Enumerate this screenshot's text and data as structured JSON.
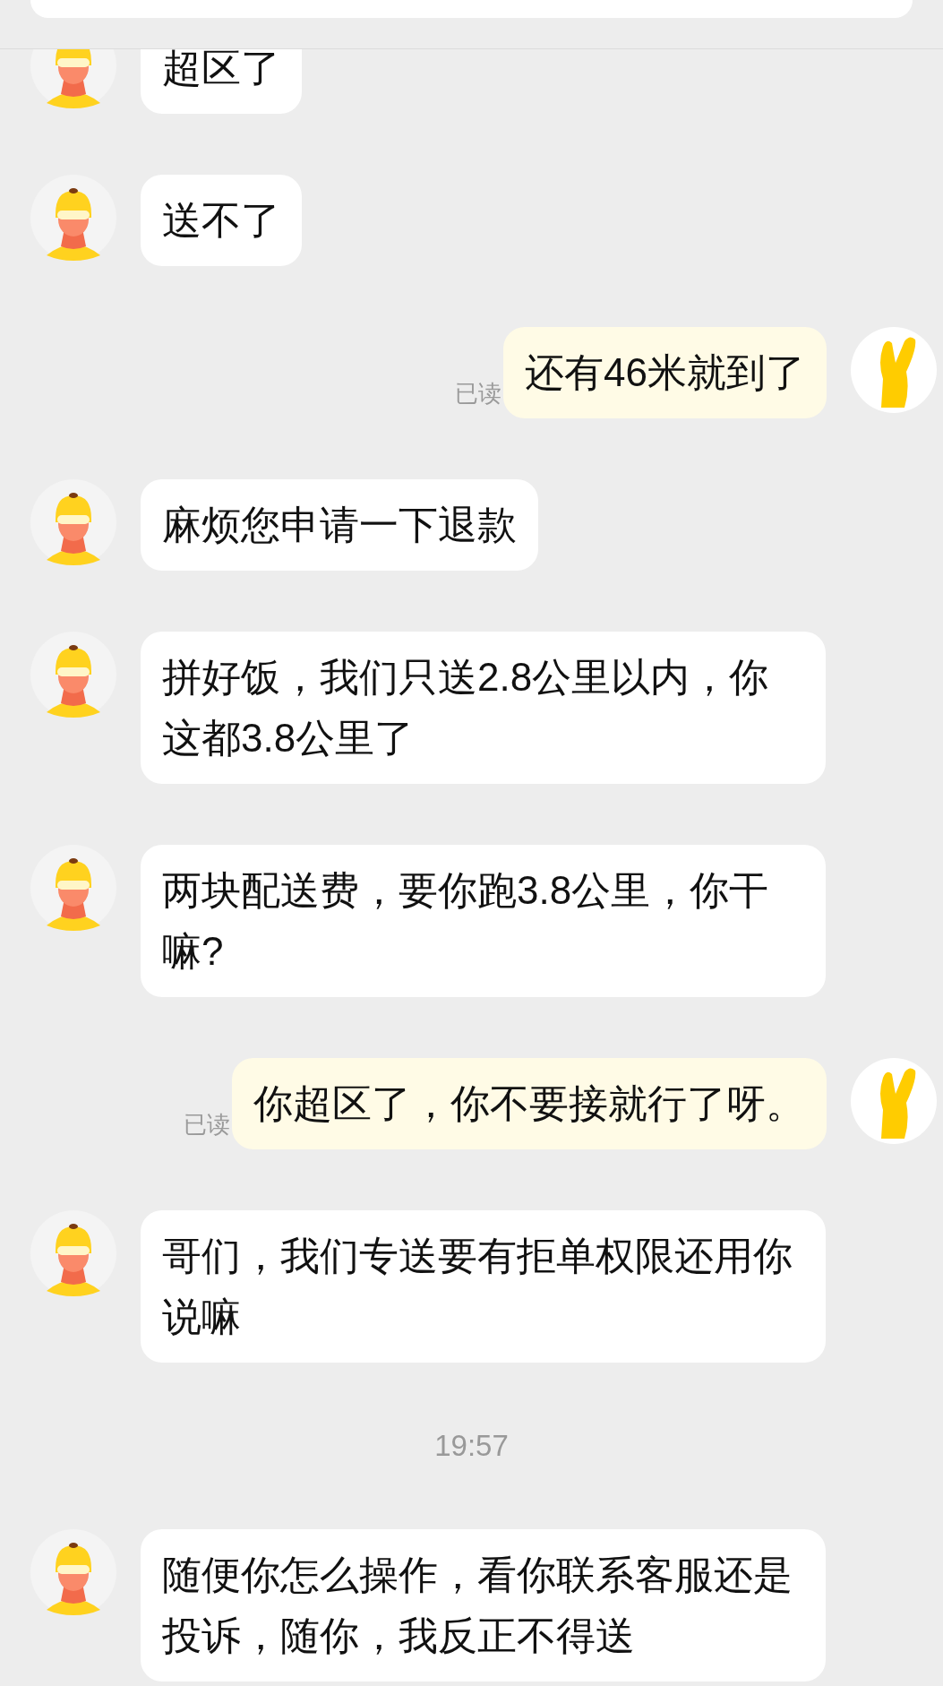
{
  "messages": [
    {
      "kind": "incoming",
      "text": "超区了"
    },
    {
      "kind": "incoming",
      "text": "送不了"
    },
    {
      "kind": "outgoing",
      "text": "还有46米就到了",
      "read": true,
      "receipt": "已读"
    },
    {
      "kind": "incoming",
      "text": "麻烦您申请一下退款"
    },
    {
      "kind": "incoming",
      "text": "拼好饭，我们只送2.8公里以内，你这都3.8公里了"
    },
    {
      "kind": "incoming",
      "text": "两块配送费，要你跑3.8公里，你干嘛?"
    },
    {
      "kind": "outgoing",
      "text": "你超区了，你不要接就行了呀。",
      "read": true,
      "receipt": "已读"
    },
    {
      "kind": "incoming",
      "text": "哥们，我们专送要有拒单权限还用你说嘛"
    },
    {
      "kind": "time",
      "text": "19:57"
    },
    {
      "kind": "incoming",
      "text": "随便你怎么操作，看你联系客服还是投诉，随你，我反正不得送"
    }
  ]
}
